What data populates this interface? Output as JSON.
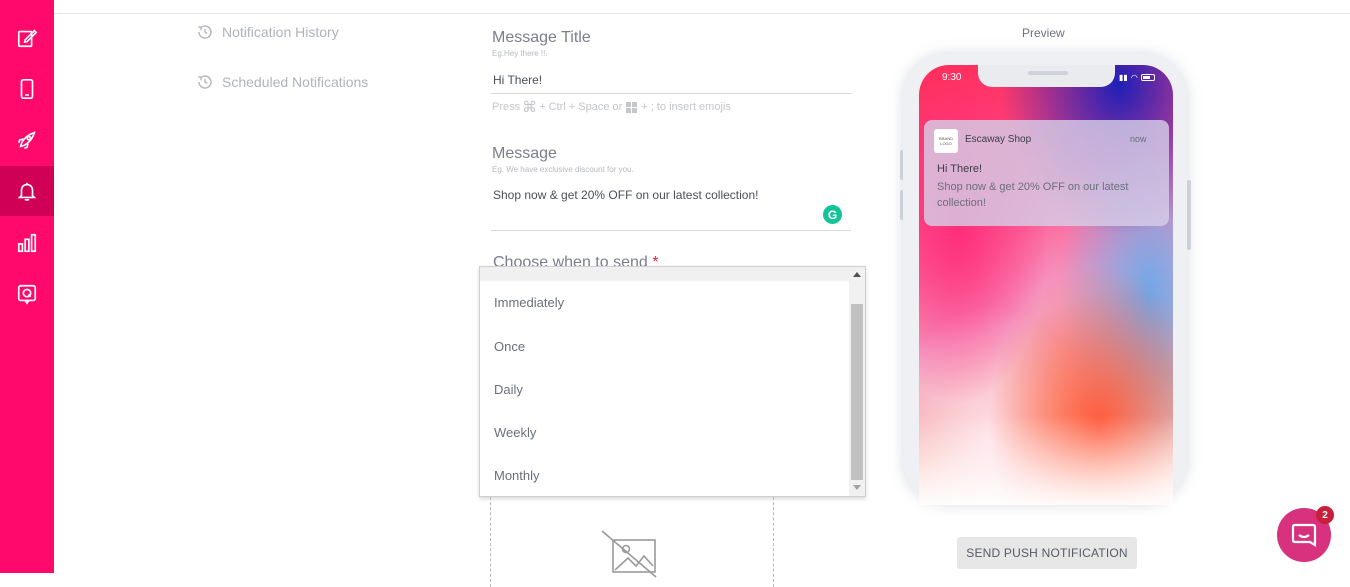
{
  "sidebar": {
    "accent_color": "#ff0a6c",
    "active_color": "#d10057",
    "items": [
      {
        "icon": "edit-icon"
      },
      {
        "icon": "mobile-icon"
      },
      {
        "icon": "rocket-icon"
      },
      {
        "icon": "bell-icon",
        "active": true
      },
      {
        "icon": "bar-chart-icon"
      },
      {
        "icon": "q-icon"
      }
    ]
  },
  "subnav": {
    "items": [
      {
        "label": "Notification History",
        "icon": "history-icon"
      },
      {
        "label": "Scheduled Notifications",
        "icon": "history-icon"
      }
    ]
  },
  "form": {
    "title": {
      "label": "Message Title",
      "hint": "Eg.Hey there !!.",
      "value": "Hi There!",
      "emoji_hint_prefix": "Press",
      "emoji_hint_mid": "+ Ctrl + Space or",
      "emoji_hint_suffix": "+ ; to insert emojis"
    },
    "message": {
      "label": "Message",
      "hint": "Eg. We have exclusive discount for you.",
      "value": "Shop now & get 20% OFF on our latest collection!"
    },
    "schedule": {
      "label": "Choose when to send",
      "required_mark": "*",
      "options": [
        "Immediately",
        "Once",
        "Daily",
        "Weekly",
        "Monthly"
      ]
    }
  },
  "preview": {
    "label": "Preview",
    "status_time": "9:30",
    "notification": {
      "logo_text": "BRAND LOGO",
      "app_name": "Escaway Shop",
      "time": "now",
      "title": "Hi There!",
      "body": "Shop now & get 20% OFF on our latest collection!"
    },
    "send_button": "SEND PUSH NOTIFICATION"
  },
  "chat": {
    "badge_count": "2",
    "color": "#d8327e"
  }
}
